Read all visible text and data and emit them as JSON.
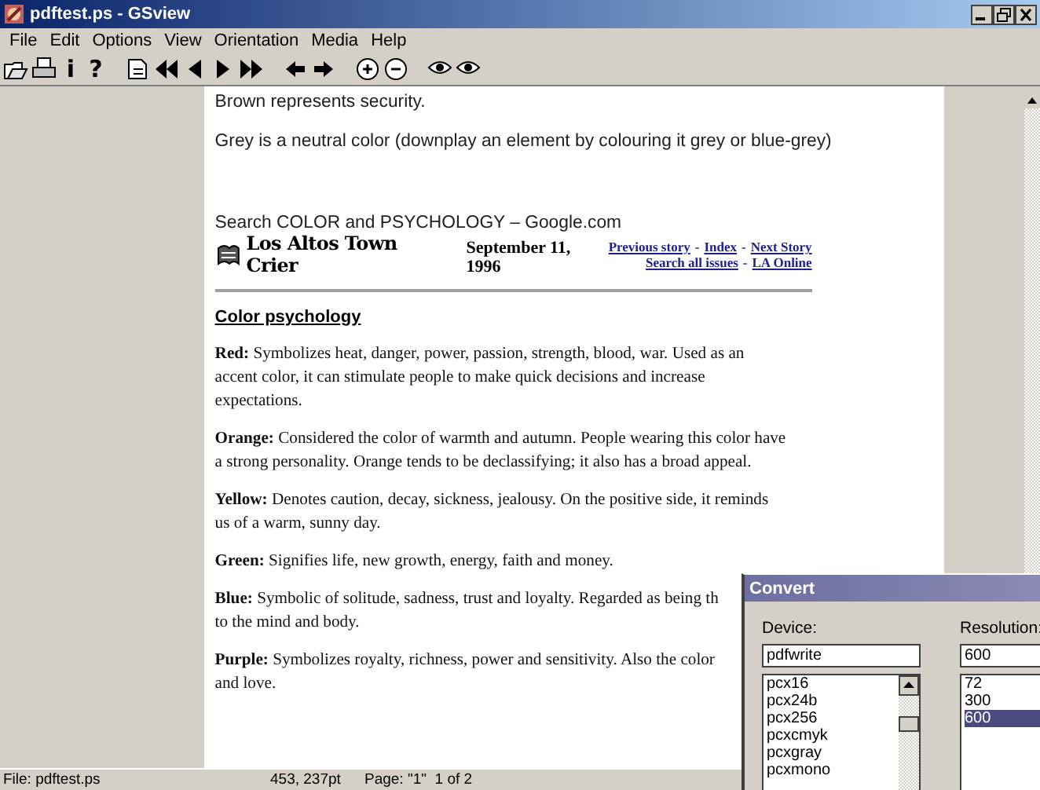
{
  "window": {
    "title": "pdftest.ps - GSview"
  },
  "menu": [
    "File",
    "Edit",
    "Options",
    "View",
    "Orientation",
    "Media",
    "Help"
  ],
  "toolbar_glyphs": [
    "i",
    "?"
  ],
  "document": {
    "intro": [
      "Brown represents security.",
      "Grey is a neutral color (downplay an element by colouring it grey or blue-grey)"
    ],
    "search_line": "Search COLOR and PSYCHOLOGY – Google.com",
    "masthead": {
      "logo": "Los Altos Town Crier",
      "date": "September 11, 1996",
      "link_rows": [
        [
          {
            "kind": "link",
            "text": "Previous story"
          },
          {
            "kind": "separator",
            "text": "-"
          },
          {
            "kind": "link",
            "text": "Index"
          },
          {
            "kind": "separator",
            "text": "-"
          },
          {
            "kind": "link",
            "text": "Next Story"
          }
        ],
        [
          {
            "kind": "link",
            "text": "Search all issues"
          },
          {
            "kind": "separator",
            "text": "-"
          },
          {
            "kind": "link",
            "text": "LA Online"
          }
        ]
      ]
    },
    "heading": "Color psychology",
    "paragraphs": [
      {
        "term": "Red:",
        "lines": [
          "Symbolizes heat, danger, power, passion, strength, blood, war. Used as an",
          "accent color, it can stimulate people to make quick decisions and increase",
          "expectations."
        ]
      },
      {
        "term": "Orange:",
        "lines": [
          "Considered the color of warmth and autumn. People wearing this color have",
          "a strong personality. Orange tends to be declassifying; it also has a broad appeal."
        ]
      },
      {
        "term": "Yellow:",
        "lines": [
          "Denotes caution, decay, sickness, jealousy. On the positive side, it reminds",
          "us of a warm, sunny day."
        ]
      },
      {
        "term": "Green:",
        "lines": [
          "Signifies life, new growth, energy, faith and money."
        ]
      },
      {
        "term": "Blue:",
        "lines": [
          "Symbolic of solitude, sadness, trust and loyalty. Regarded as being th",
          "to the mind and body."
        ]
      },
      {
        "term": "Purple:",
        "lines": [
          "Symbolizes royalty, richness, power and sensitivity. Also the color",
          "and love."
        ]
      }
    ]
  },
  "dialog": {
    "title": "Convert",
    "device_label": "Device:",
    "device_value": "pdfwrite",
    "devices": [
      {
        "text": "pcx16",
        "selected": false
      },
      {
        "text": "pcx24b",
        "selected": false
      },
      {
        "text": "pcx256",
        "selected": false
      },
      {
        "text": "pcxcmyk",
        "selected": false
      },
      {
        "text": "pcxgray",
        "selected": false
      },
      {
        "text": "pcxmono",
        "selected": false
      }
    ],
    "resolution_label": "Resolution:",
    "resolution_value": "600",
    "resolutions": [
      {
        "text": "72",
        "selected": false
      },
      {
        "text": "300",
        "selected": false
      },
      {
        "text": "600",
        "selected": true
      }
    ]
  },
  "status_bar": {
    "file": "File: pdftest.ps",
    "position": "453, 237pt",
    "page": "Page: \"1\"  1 of 2"
  }
}
